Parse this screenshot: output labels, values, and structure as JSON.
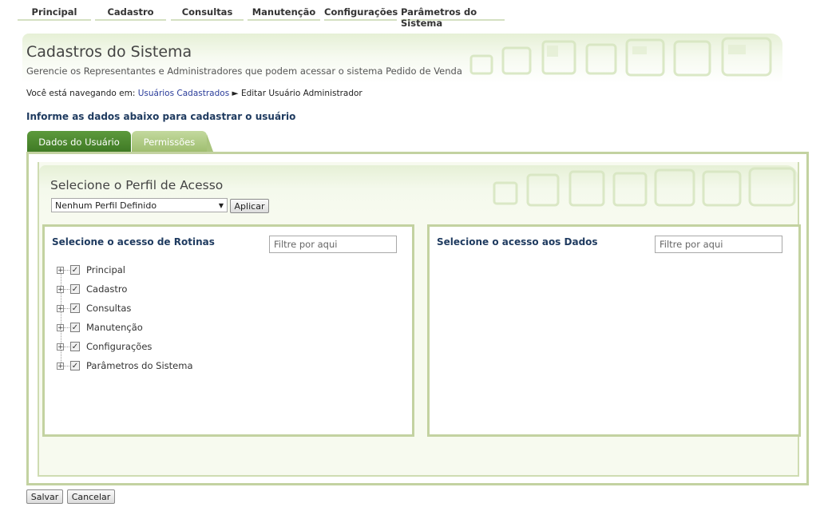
{
  "nav": {
    "items": [
      "Principal",
      "Cadastro",
      "Consultas",
      "Manutenção",
      "Configurações",
      "Parâmetros do Sistema"
    ]
  },
  "header": {
    "title": "Cadastros do Sistema",
    "subtitle": "Gerencie os Representantes e Administradores que podem acessar o sistema Pedido de Venda"
  },
  "breadcrumb": {
    "prefix": "Você está navegando em:",
    "link": "Usuários Cadastrados",
    "separator": "►",
    "current": "Editar Usuário Administrador"
  },
  "instruction": "Informe as dados abaixo para cadastrar o usuário",
  "tabs": {
    "dados": "Dados do Usuário",
    "permissoes": "Permissões",
    "active": "Permissões"
  },
  "profile": {
    "title": "Selecione o Perfil de Acesso",
    "selected": "Nenhum Perfil Definido",
    "apply_label": "Aplicar"
  },
  "rotinas": {
    "title": "Selecione o acesso de Rotinas",
    "filter_placeholder": "Filtre por aqui",
    "items": [
      "Principal",
      "Cadastro",
      "Consultas",
      "Manutenção",
      "Configurações",
      "Parâmetros do Sistema"
    ]
  },
  "dados_acesso": {
    "title": "Selecione o acesso aos Dados",
    "filter_placeholder": "Filtre por aqui"
  },
  "actions": {
    "save_label": "Salvar",
    "cancel_label": "Cancelar"
  },
  "icons": {
    "expander": "plus-expander-icon",
    "checkbox": "checkbox-checked-icon",
    "dropdown": "chevron-down-icon"
  },
  "colors": {
    "accent_green": "#3f7a25",
    "border_green": "#c3d2a1",
    "title_blue": "#1e3a5f",
    "link_blue": "#2a3c9a"
  }
}
